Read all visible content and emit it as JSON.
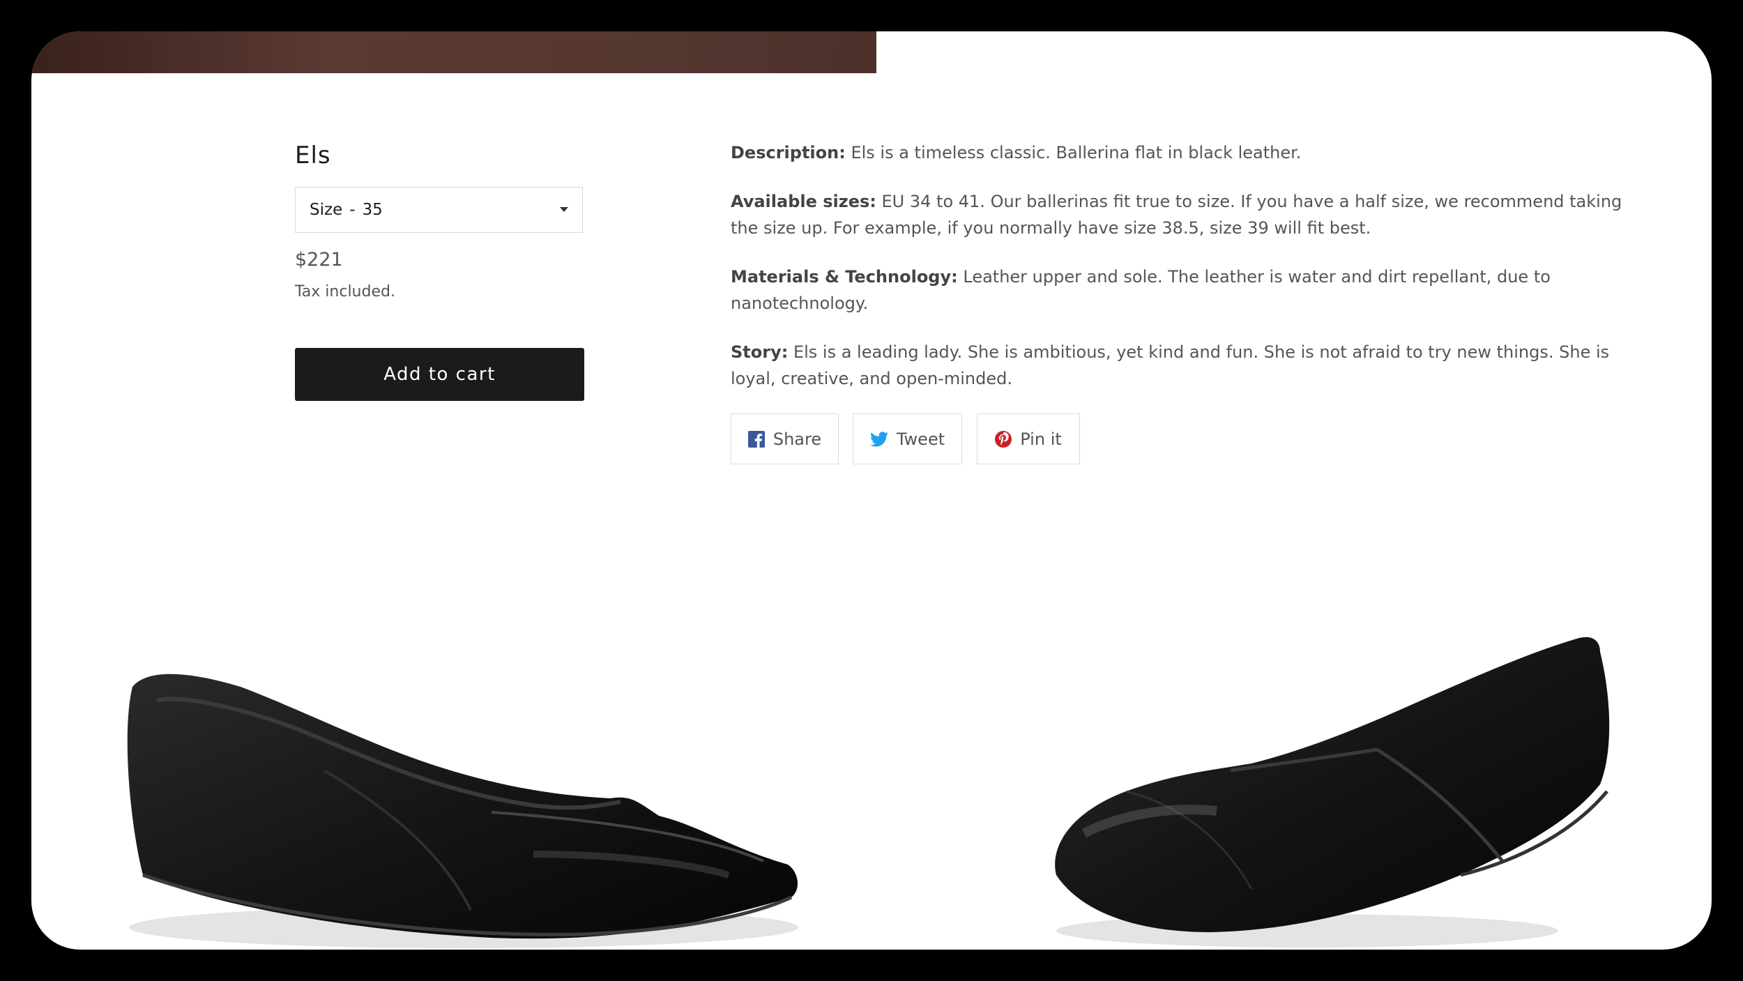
{
  "product": {
    "title": "Els",
    "size_select": {
      "label": "Size",
      "separator": "-",
      "value": "35"
    },
    "price": "$221",
    "tax_note": "Tax included.",
    "add_to_cart_label": "Add to cart"
  },
  "description": [
    {
      "label": "Description:",
      "text": " Els is a timeless classic. Ballerina flat in black leather."
    },
    {
      "label": "Available sizes:",
      "text": " EU 34 to 41. Our ballerinas fit true to size. If you have a half size, we recommend taking the size up. For example, if you normally have size 38.5, size 39 will fit best."
    },
    {
      "label": "Materials & Technology:",
      "text": " Leather upper and sole. The leather is water and dirt repellant, due to nanotechnology."
    },
    {
      "label": "Story:",
      "text": " Els is a leading lady. She is ambitious, yet kind and fun. She is not afraid to try new things. She is loyal, creative, and open-minded."
    }
  ],
  "social": {
    "share_label": "Share",
    "tweet_label": "Tweet",
    "pin_label": "Pin it"
  },
  "colors": {
    "facebook": "#3b5998",
    "twitter": "#1da1f2",
    "pinterest": "#cb2027",
    "button_bg": "#1b1b1b",
    "hero_strip": "#5a3a33"
  },
  "icons": [
    "facebook-icon",
    "twitter-icon",
    "pinterest-icon",
    "chevron-down-icon"
  ]
}
